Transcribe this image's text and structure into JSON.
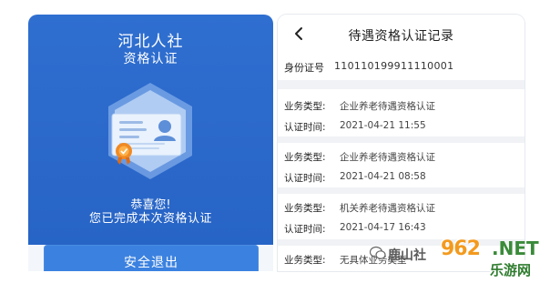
{
  "left": {
    "title": "河北人社",
    "subtitle": "资格认证",
    "congrats": "恭喜您!",
    "completed_message": "您已完成本次资格认证",
    "exit_button": "安全退出",
    "colors": {
      "background": "#2a67c9",
      "button": "#3b82e0",
      "medal": "#f08a24"
    }
  },
  "right": {
    "title": "待遇资格认证记录",
    "id_label": "身份证号",
    "id_value": "110110199911110001",
    "records": [
      {
        "type_label": "业务类型:",
        "type": "企业养老待遇资格认证",
        "time_label": "认证时间:",
        "time": "2021-04-21 11:55"
      },
      {
        "type_label": "业务类型:",
        "type": "企业养老待遇资格认证",
        "time_label": "认证时间:",
        "time": "2021-04-21 08:58"
      },
      {
        "type_label": "业务类型:",
        "type": "机关养老待遇资格认证",
        "time_label": "认证时间:",
        "time": "2021-04-17 16:43"
      },
      {
        "type_label": "业务类型:",
        "type": "无具体业务类型",
        "time_label": "",
        "time": ""
      }
    ]
  },
  "watermark": {
    "site": "鹿山社",
    "number": "962",
    "suffix": ".NET",
    "cn": "乐游网"
  }
}
